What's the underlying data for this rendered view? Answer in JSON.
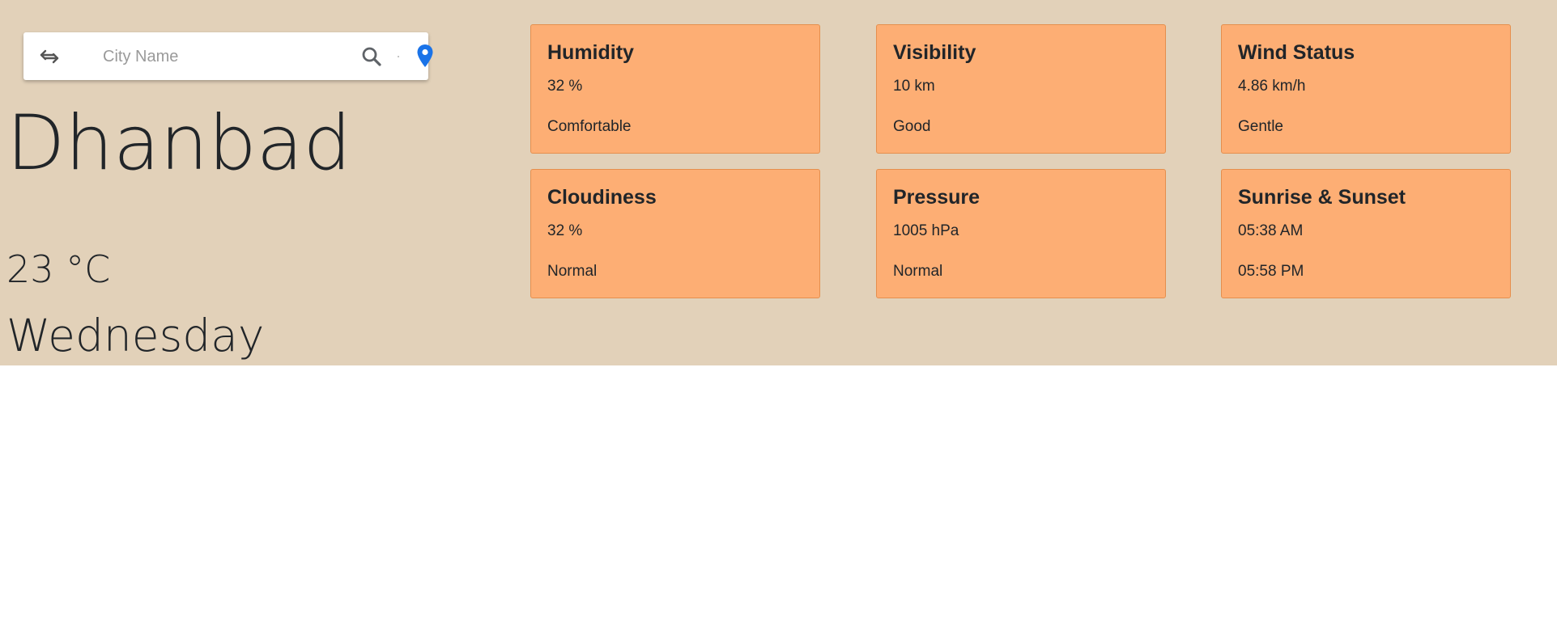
{
  "search": {
    "placeholder": "City Name",
    "swap_icon": "swap-arrows-icon",
    "search_icon": "search-icon",
    "location_icon": "location-pin-icon",
    "location_icon_color": "#1a73e8"
  },
  "weather": {
    "city": "Dhanbad",
    "temperature": "23 °C",
    "day": "Wednesday"
  },
  "cards": [
    {
      "title": "Humidity",
      "value": "32 %",
      "status": "Comfortable"
    },
    {
      "title": "Visibility",
      "value": "10 km",
      "status": "Good"
    },
    {
      "title": "Wind Status",
      "value": "4.86 km/h",
      "status": "Gentle"
    },
    {
      "title": "Cloudiness",
      "value": "32 %",
      "status": "Normal"
    },
    {
      "title": "Pressure",
      "value": "1005 hPa",
      "status": "Normal"
    },
    {
      "title": "Sunrise & Sunset",
      "value": "05:38 AM",
      "status": "05:58 PM"
    }
  ],
  "colors": {
    "background": "#e2d1b9",
    "card": "#fdae74",
    "card_border": "#e58f4e"
  }
}
